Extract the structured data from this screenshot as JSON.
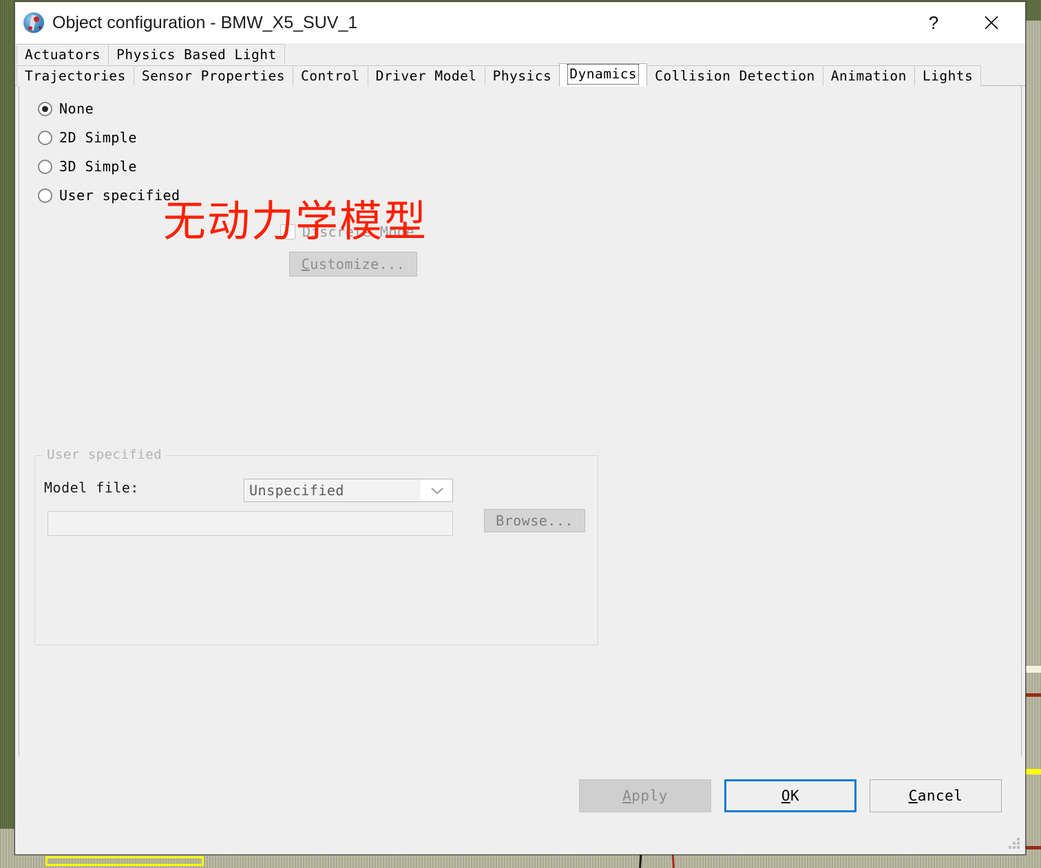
{
  "window": {
    "title": "Object configuration - BMW_X5_SUV_1",
    "icon": "app-globe-icon",
    "help_label": "?",
    "close_label": "✕"
  },
  "tabs": {
    "row1": [
      {
        "label": "Actuators",
        "selected": false
      },
      {
        "label": "Physics Based Light",
        "selected": false
      }
    ],
    "row2": [
      {
        "label": "Trajectories",
        "selected": false
      },
      {
        "label": "Sensor Properties",
        "selected": false
      },
      {
        "label": "Control",
        "selected": false
      },
      {
        "label": "Driver Model",
        "selected": false
      },
      {
        "label": "Physics",
        "selected": false
      },
      {
        "label": "Dynamics",
        "selected": true
      },
      {
        "label": "Collision Detection",
        "selected": false
      },
      {
        "label": "Animation",
        "selected": false
      },
      {
        "label": "Lights",
        "selected": false
      }
    ]
  },
  "dynamics": {
    "options": [
      {
        "label": "None",
        "checked": true
      },
      {
        "label": "2D Simple",
        "checked": false
      },
      {
        "label": "3D Simple",
        "checked": false
      },
      {
        "label": "User specified",
        "checked": false
      }
    ],
    "discrete_mode": {
      "label": "Discrete Mode",
      "checked": false,
      "disabled": true
    },
    "customize_button": {
      "accel": "C",
      "rest": "ustomize...",
      "disabled": true
    },
    "annotation": {
      "text": "无动力学模型",
      "color": "#ff2000"
    }
  },
  "user_specified_group": {
    "legend": "User specified",
    "model_file_label": "Model file:",
    "model_type_value": "Unspecified",
    "model_type_placeholder": "Unspecified",
    "model_file_value": "",
    "model_file_placeholder": "",
    "browse_button": "Browse..."
  },
  "footer": {
    "apply": {
      "accel": "A",
      "rest": "pply",
      "disabled": true
    },
    "ok": {
      "accel": "O",
      "rest": "K",
      "focused": true
    },
    "cancel": {
      "accel": "C",
      "rest": "ancel",
      "focused": false
    }
  },
  "colors": {
    "dialog_background": "#efefef",
    "titlebar_background": "#ffffff",
    "focus_accent": "#0a7bd4",
    "annotation_red": "#ff2000",
    "disabled_text": "#8a8a8a",
    "scene_grass": "#5a6b38",
    "scene_ground": "#b9b9a0"
  }
}
